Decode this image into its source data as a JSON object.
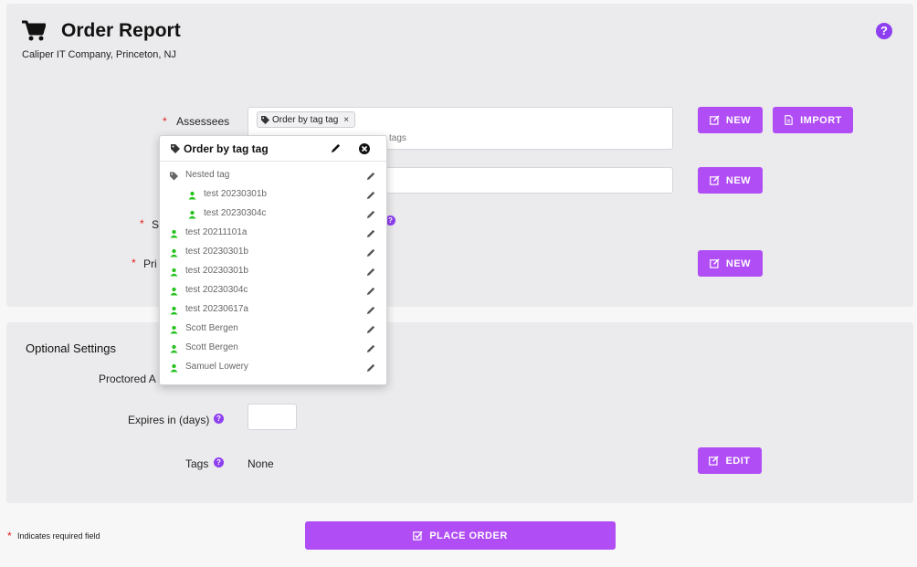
{
  "header": {
    "title": "Order Report",
    "subtitle": "Caliper IT Company, Princeton, NJ",
    "help_glyph": "?"
  },
  "form": {
    "required_mark": "*",
    "assessees_label": "Assessees",
    "second_label_fragment": "S",
    "third_label_fragment": "Pri",
    "assessees_chip": "Order by tag tag",
    "assessees_hint": "tags",
    "new_label": "NEW",
    "import_label": "IMPORT"
  },
  "popup": {
    "title": "Order by tag tag",
    "items": [
      {
        "label": "Nested tag",
        "type": "tag",
        "indent": 0
      },
      {
        "label": "test 20230301b",
        "type": "user",
        "indent": 1
      },
      {
        "label": "test 20230304c",
        "type": "user",
        "indent": 1
      },
      {
        "label": "test 20211101a",
        "type": "user",
        "indent": 0
      },
      {
        "label": "test 20230301b",
        "type": "user",
        "indent": 0
      },
      {
        "label": "test 20230301b",
        "type": "user",
        "indent": 0
      },
      {
        "label": "test 20230304c",
        "type": "user",
        "indent": 0
      },
      {
        "label": "test 20230617a",
        "type": "user",
        "indent": 0
      },
      {
        "label": "Scott Bergen",
        "type": "user",
        "indent": 0
      },
      {
        "label": "Scott Bergen",
        "type": "user",
        "indent": 0
      },
      {
        "label": "Samuel Lowery",
        "type": "user",
        "indent": 0
      }
    ]
  },
  "optional": {
    "heading": "Optional Settings",
    "proctored_label": "Proctored A",
    "expires_label": "Expires in (days)",
    "expires_value": "",
    "tags_label": "Tags",
    "tags_value": "None",
    "edit_label": "EDIT"
  },
  "footer": {
    "required_legend": "Indicates required field",
    "place_order_label": "PLACE ORDER"
  },
  "colors": {
    "accent": "#b04df5",
    "help": "#8e3ff0",
    "required": "#e0201c",
    "user_icon": "#25c21e"
  },
  "icons": {
    "header": "shopping-cart-icon",
    "new_button": "edit-square-icon",
    "import_button": "file-icon",
    "place_order": "check-square-icon",
    "tag": "tag-icon",
    "user": "user-icon",
    "row_action": "pencil-icon",
    "close": "close-circle-icon"
  }
}
